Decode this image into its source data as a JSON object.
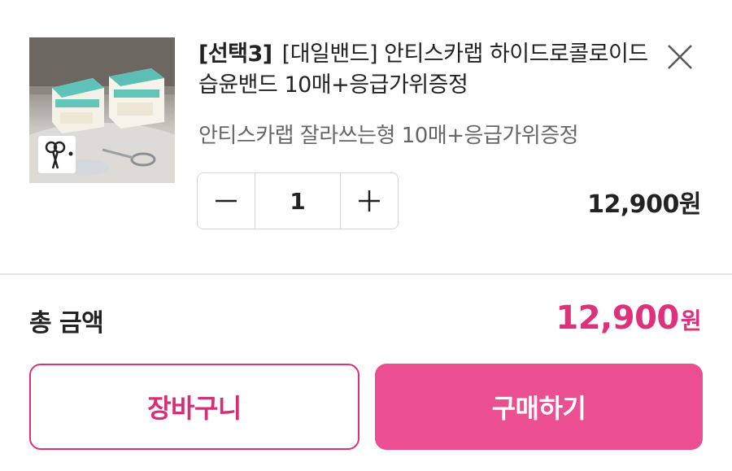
{
  "product": {
    "tag": "[선택3]",
    "name": "[대일밴드] 안티스카랩 하이드로콜로이드 습윤밴드 10매+응급가위증정",
    "option": "안티스카랩 잘라쓰는형 10매+응급가위증정",
    "image_icon": "product-photo",
    "badge_icon": "scissors-icon"
  },
  "close": {
    "icon": "close-icon"
  },
  "quantity": {
    "value": "1",
    "decrease_icon": "minus-icon",
    "increase_icon": "plus-icon"
  },
  "item_price": "12,900원",
  "total": {
    "label": "총 금액",
    "amount": "12,900",
    "unit": "원"
  },
  "actions": {
    "cart_label": "장바구니",
    "buy_label": "구매하기"
  },
  "colors": {
    "accent": "#e0307c",
    "buy_button": "#ec4f91",
    "text": "#222222",
    "subtext": "#666666"
  }
}
